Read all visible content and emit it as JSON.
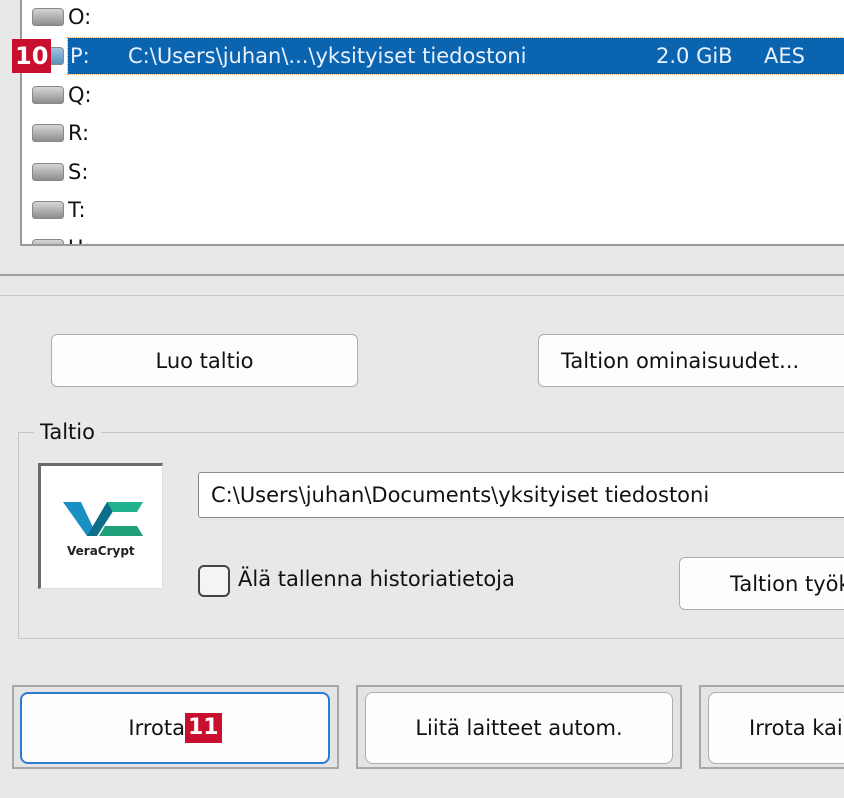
{
  "drive_list": [
    {
      "letter": "O:"
    },
    {
      "letter": "P:",
      "path": "C:\\Users\\juhan\\...\\yksityiset tiedostoni",
      "size": "2.0 GiB",
      "encryption": "AES",
      "selected": true
    },
    {
      "letter": "Q:"
    },
    {
      "letter": "R:"
    },
    {
      "letter": "S:"
    },
    {
      "letter": "T:"
    },
    {
      "letter": "U:"
    }
  ],
  "annotations": {
    "badge_list": "10",
    "badge_dismount": "11"
  },
  "buttons": {
    "create_volume": "Luo taltio",
    "volume_properties": "Taltion ominaisuudet...",
    "volume_tools": "Taltion työkalut...",
    "dismount": "Irrota",
    "auto_mount": "Liitä laitteet autom.",
    "dismount_all": "Irrota kaikki"
  },
  "volume_group": {
    "label": "Taltio",
    "path_value": "C:\\Users\\juhan\\Documents\\yksityiset tiedostoni",
    "never_save_history": "Älä tallenna historiatietoja",
    "never_save_history_checked": false,
    "logo_text": "VeraCrypt"
  },
  "colors": {
    "selection": "#0a64b0",
    "badge": "#c8102e",
    "focus": "#2b7cd3"
  }
}
